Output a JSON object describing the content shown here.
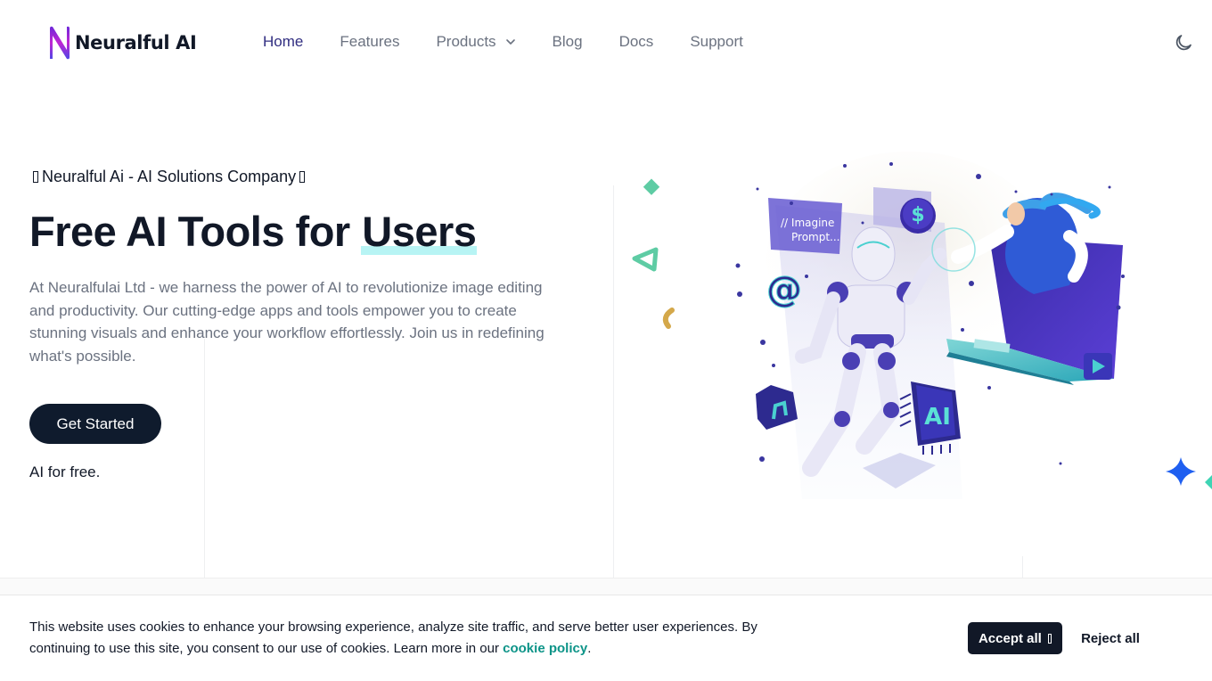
{
  "header": {
    "logo_text": "Neuralful AI",
    "nav": [
      {
        "label": "Home",
        "active": true
      },
      {
        "label": "Features",
        "active": false
      },
      {
        "label": "Products",
        "active": false,
        "has_dropdown": true
      },
      {
        "label": "Blog",
        "active": false
      },
      {
        "label": "Docs",
        "active": false
      },
      {
        "label": "Support",
        "active": false
      }
    ],
    "theme_toggle_icon": "moon-icon"
  },
  "hero": {
    "tagline": "Neuralful Ai - AI Solutions Company",
    "title_prefix": "Free AI Tools for ",
    "title_highlight": "Users",
    "description": "At Neuralfulai Ltd - we harness the power of AI to revolutionize image editing and productivity. Our cutting-edge apps and tools empower you to create stunning visuals and enhance your workflow effortlessly. Join us in redefining what's possible.",
    "cta_label": "Get Started",
    "subnote": "AI for free.",
    "illustration": {
      "prompt_card_line1": "// Imagine",
      "prompt_card_line2": "Prompt...",
      "chip_label": "AI",
      "coin_symbol": "$",
      "at_symbol": "@"
    }
  },
  "cookie_banner": {
    "text_before_link": "This website uses cookies to enhance your browsing experience, analyze site traffic, and serve better user experiences. By continuing to use this site, you consent to our use of cookies. Learn more in our ",
    "link_text": "cookie policy",
    "text_after_link": ".",
    "accept_label": "Accept all",
    "reject_label": "Reject all"
  },
  "colors": {
    "brand_dark": "#0f1b2d",
    "nav_active": "#312e81",
    "highlight": "#b7f4f4",
    "link": "#0d9488"
  }
}
